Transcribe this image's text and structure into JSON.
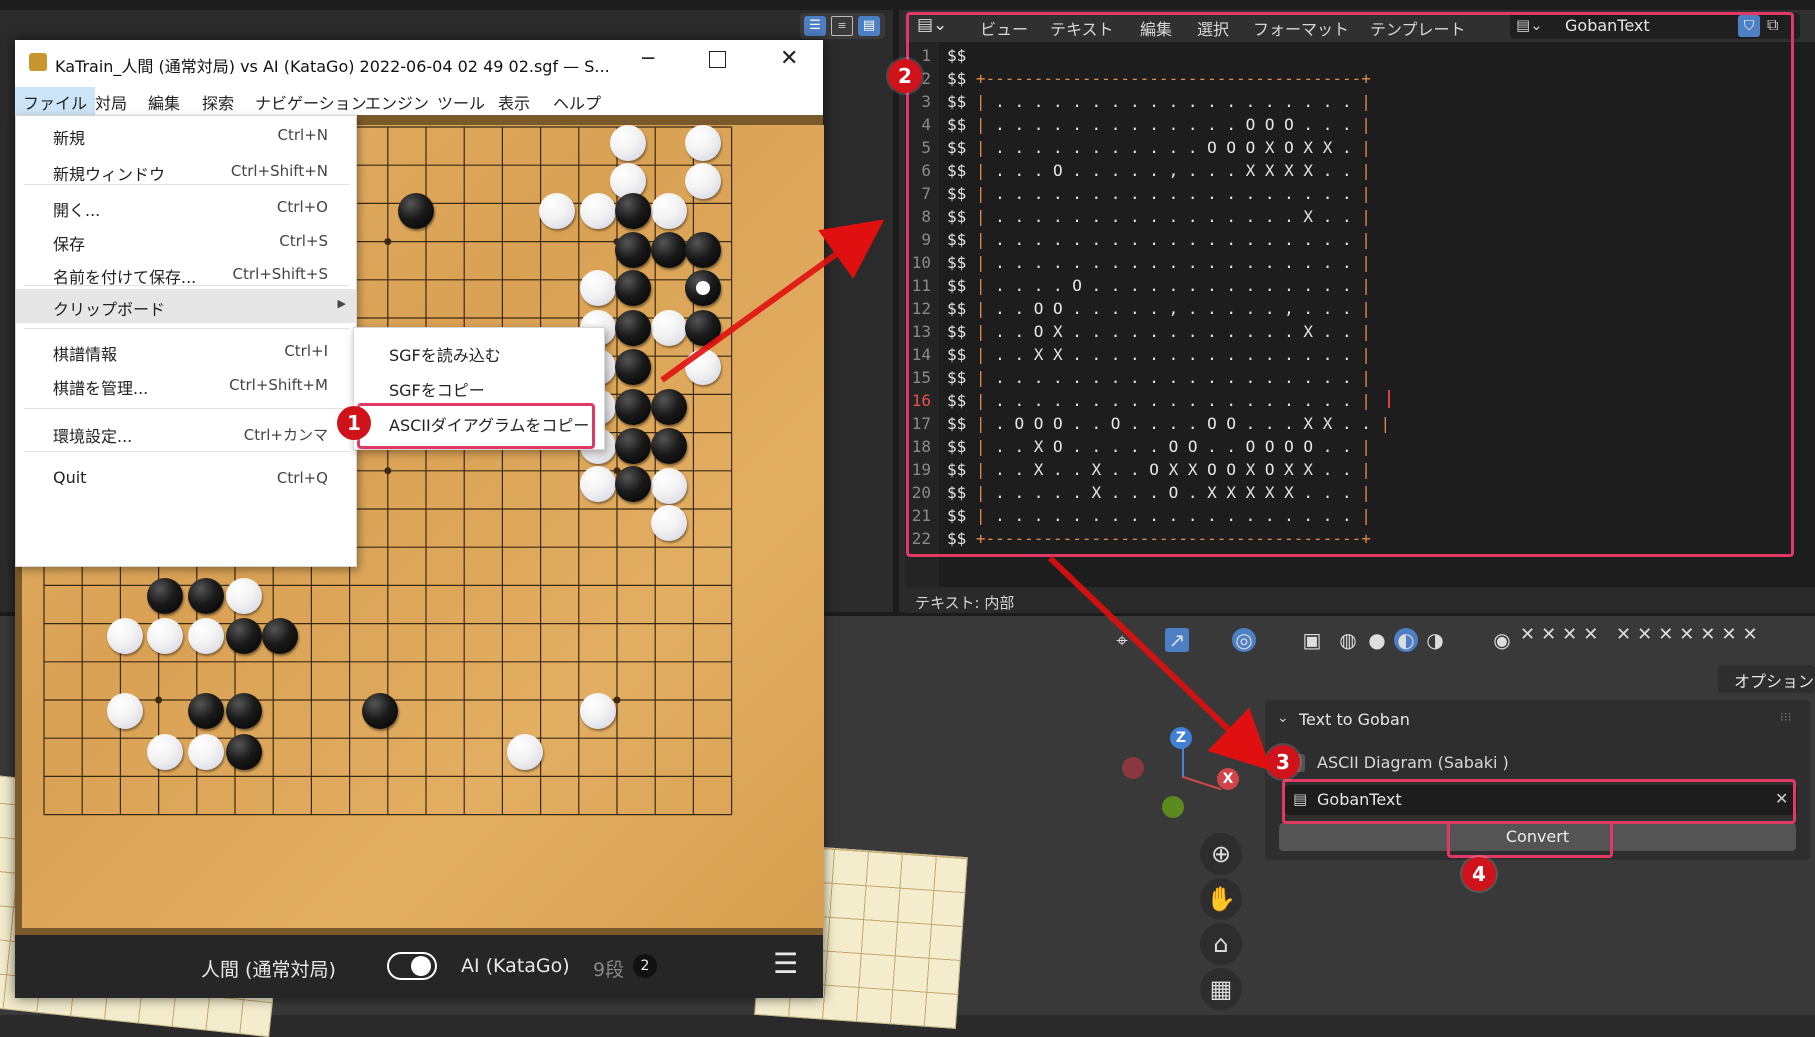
{
  "katrain": {
    "title": "KaTrain_人間 (通常対局) vs AI (KataGo) 2022-06-04 02 49 02.sgf — S...",
    "menu": [
      "ファイル",
      "対局",
      "編集",
      "探索",
      "ナビゲーション",
      "エンジン",
      "ツール",
      "表示",
      "ヘルプ"
    ],
    "file_menu": [
      {
        "label": "新規",
        "shortcut": "Ctrl+N"
      },
      {
        "label": "新規ウィンドウ",
        "shortcut": "Ctrl+Shift+N"
      },
      {
        "label": "開く...",
        "shortcut": "Ctrl+O"
      },
      {
        "label": "保存",
        "shortcut": "Ctrl+S"
      },
      {
        "label": "名前を付けて保存...",
        "shortcut": "Ctrl+Shift+S"
      },
      {
        "label": "クリップボード",
        "shortcut": ""
      },
      {
        "label": "棋譜情報",
        "shortcut": "Ctrl+I"
      },
      {
        "label": "棋譜を管理...",
        "shortcut": "Ctrl+Shift+M"
      },
      {
        "label": "環境設定...",
        "shortcut": "Ctrl+カンマ"
      },
      {
        "label": "Quit",
        "shortcut": "Ctrl+Q"
      }
    ],
    "clipboard_submenu": [
      "SGFを読み込む",
      "SGFをコピー",
      "ASCIIダイアグラムをコピー"
    ],
    "footer": {
      "player_black": "人間 (通常対局)",
      "player_white": "AI (KataGo)",
      "rank": "9段",
      "badge": "2"
    }
  },
  "editor": {
    "menu": [
      "ビュー",
      "テキスト",
      "編集",
      "選択",
      "フォーマット",
      "テンプレート"
    ],
    "datablock_name": "GobanText",
    "footer": "テキスト: 内部",
    "current_line": 16,
    "lines": [
      "$$",
      "$$ +---------------------------------------+",
      "$$ | . . . . . . . . . . . . . . . . . . . |",
      "$$ | . . . . . . . . . . . . . O O O . . . |",
      "$$ | . . . . . . . . . . . O O O X O X X . |",
      "$$ | . . . O . . . . . , . . . X X X X . . |",
      "$$ | . . . . . . . . . . . . . . . . . . . |",
      "$$ | . . . . . . . . . . . . . . . . X . . |",
      "$$ | . . . . . . . . . . . . . . . . . . . |",
      "$$ | . . . . . . . . . . . . . . . . . . . |",
      "$$ | . . . . O . . . . . . . . . . . . . . |",
      "$$ | . . O O . . . . . , . . . . . , . . . |",
      "$$ | . . O X . . . . . . . . . . . . X . . |",
      "$$ | . . X X . . . . . . . . . . . . . . . |",
      "$$ | . . . . . . . . . . . . . . . . . . . |",
      "$$ | . . . . . . . . . . . . . . . . . . . |",
      "$$ | . O O O . . O . . . . O O . . . X X . . |",
      "$$ | . . X O . . . . . O O . . O O O O . . |",
      "$$ | . . X . . X . . O X X O O X O X X . . |",
      "$$ | . . . . . X . . . O . X X X X X . . . |",
      "$$ | . . . . . . . . . . . . . . . . . . . |",
      "$$ +---------------------------------------+"
    ]
  },
  "panel": {
    "header": "Text to Goban",
    "options_label": "オプション",
    "checkbox_label": "ASCII Diagram (Sabaki )",
    "text_field": "GobanText",
    "convert_button": "Convert"
  },
  "badges": [
    "1",
    "2",
    "3",
    "4"
  ],
  "gizmo": {
    "z": "Z",
    "x": "X"
  },
  "colors": {
    "highlight": "#e03a64",
    "badge": "#d0121b",
    "black_stone": "#111111",
    "white_stone": "#f2f2f2"
  }
}
